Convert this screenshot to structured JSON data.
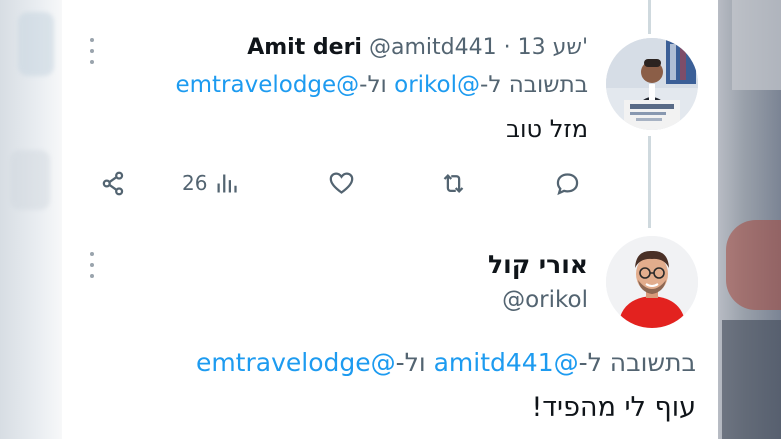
{
  "tweet1": {
    "author_name": "Amit deri",
    "author_handle": "@amitd441",
    "separator": "·",
    "time": "13 שע'",
    "reply_prefix": "בתשובה ל-",
    "reply_mention_1": "@orikol",
    "reply_joiner": " ול-",
    "reply_mention_2": "@emtravelodge",
    "text": "מזל טוב",
    "views_count": "26"
  },
  "tweet2": {
    "author_name": "אורי קול",
    "author_handle": "@orikol",
    "reply_prefix": "בתשובה ל-",
    "reply_mention_1": "@amitd441",
    "reply_joiner": " ול-",
    "reply_mention_2": "@emtravelodge",
    "text": "עוף לי מהפיד!"
  },
  "icons": {
    "share": "share-icon",
    "views": "views-bar-chart-icon",
    "like": "heart-icon",
    "retweet": "retweet-icon",
    "reply": "reply-bubble-icon",
    "more": "more-vertical-icon"
  },
  "colors": {
    "link": "#1d9bf0",
    "muted": "#536471",
    "text": "#0f1419",
    "thread_line": "#cfd9de"
  }
}
